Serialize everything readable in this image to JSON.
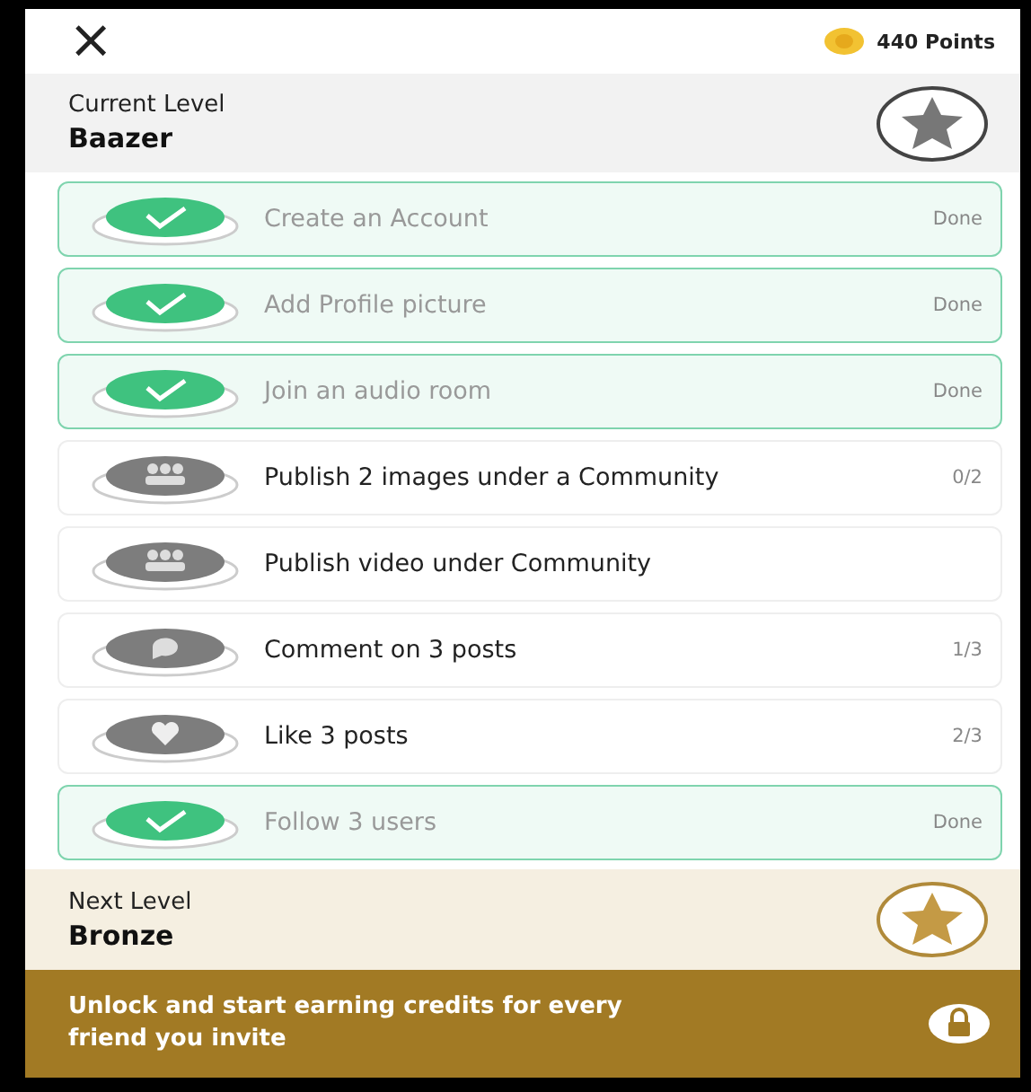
{
  "header": {
    "close": "×",
    "points": "440 Points"
  },
  "current_level": {
    "label": "Current Level",
    "name": "Baazer"
  },
  "tasks": [
    {
      "title": "Create an Account",
      "done": true,
      "kind": "check",
      "progress": "Done"
    },
    {
      "title": "Add Profile picture",
      "done": true,
      "kind": "check",
      "progress": "Done"
    },
    {
      "title": "Join an audio room",
      "done": true,
      "kind": "check",
      "progress": "Done"
    },
    {
      "title": "Publish 2 images under a Community",
      "done": false,
      "kind": "community",
      "progress": "0/2"
    },
    {
      "title": "Publish video under Community",
      "done": false,
      "kind": "community"
    },
    {
      "title": "Comment on 3 posts",
      "done": false,
      "kind": "comment",
      "progress": "1/3"
    },
    {
      "title": "Like 3 posts",
      "done": false,
      "kind": "heart",
      "progress": "2/3"
    },
    {
      "title": "Follow 3 users",
      "done": true,
      "kind": "check",
      "progress": "Done"
    }
  ],
  "next_level": {
    "label": "Next Level",
    "name": "Bronze"
  },
  "banner": {
    "text": "Unlock and start earning credits for every friend you invite"
  }
}
